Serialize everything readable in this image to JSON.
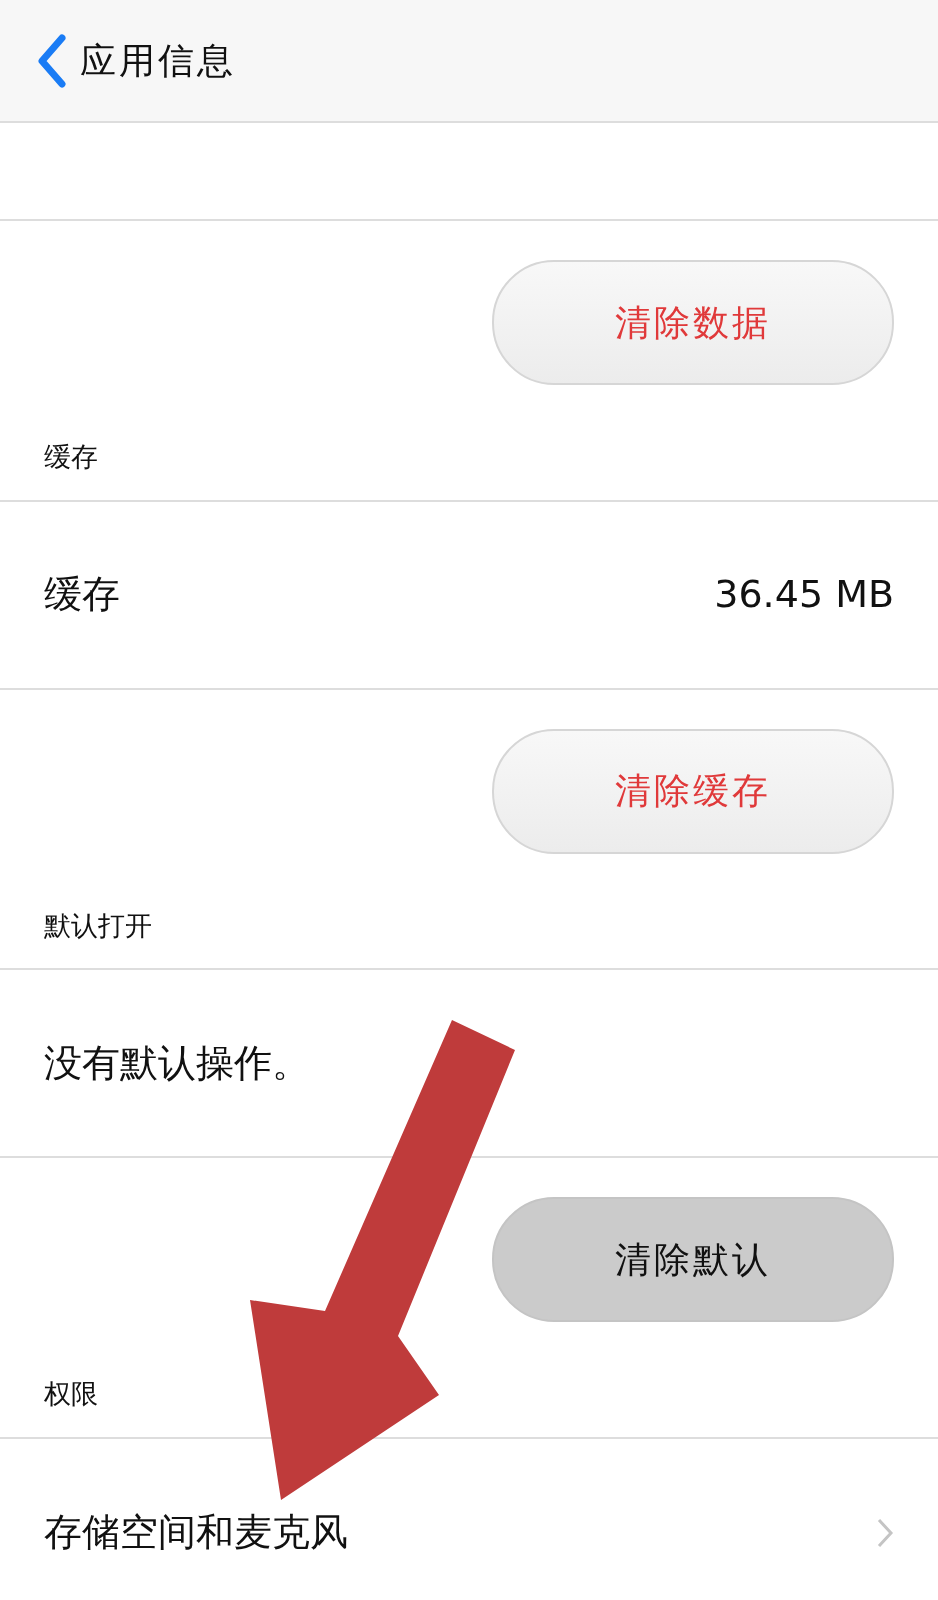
{
  "header": {
    "title": "应用信息"
  },
  "items": [
    {
      "kind": "spacer"
    },
    {
      "kind": "button",
      "label": "清除数据",
      "pressed": false
    },
    {
      "kind": "section",
      "label": "缓存"
    },
    {
      "kind": "row",
      "label": "缓存",
      "value": "36.45  MB"
    },
    {
      "kind": "button",
      "label": "清除缓存",
      "pressed": false
    },
    {
      "kind": "section",
      "label": "默认打开"
    },
    {
      "kind": "text",
      "label": "没有默认操作。"
    },
    {
      "kind": "button",
      "label": "清除默认",
      "pressed": true
    },
    {
      "kind": "section",
      "label": "权限"
    },
    {
      "kind": "link",
      "label": "存储空间和麦克风"
    }
  ]
}
